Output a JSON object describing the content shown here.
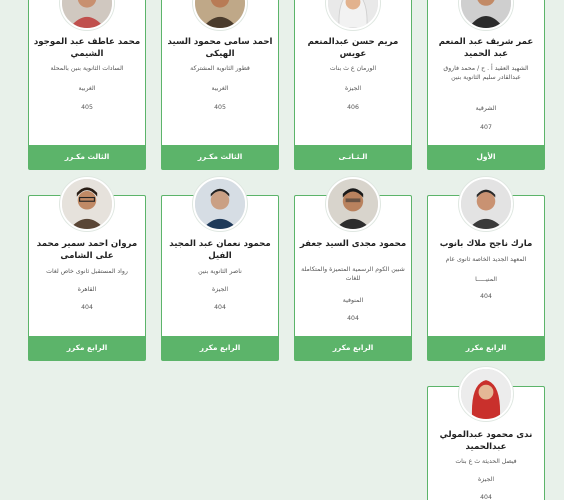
{
  "colors": {
    "accent": "#5cb46a",
    "background": "#e8f1ea",
    "card": "#ffffff"
  },
  "row1": [
    {
      "name": "عمر شريف عبد المنعم عبد الحميد",
      "school": "الشهيد العقيد أ . ح / محمد فاروق عبدالقادر سليم الثانوية بنين",
      "governorate": "الشرقية",
      "score": "407",
      "rank": "الأول",
      "avatar": "student-photo-icon"
    },
    {
      "name": "مريم حسن عبدالمنعم عويس",
      "school": "الورمان ع ث بنات",
      "governorate": "الجيزة",
      "score": "406",
      "rank": "الـثـانـى",
      "avatar": "student-photo-icon"
    },
    {
      "name": "احمد سامى محمود السيد الهيكى",
      "school": "قطور الثانوية المشتركة",
      "governorate": "الغربية",
      "score": "405",
      "rank": "الثالث مكـرر",
      "avatar": "student-photo-icon"
    },
    {
      "name": "محمد عاطف عبد الموجود الشيمي",
      "school": "السادات الثانوية بنين بالمحلة",
      "governorate": "الغربية",
      "score": "405",
      "rank": "الثالث مكـرر",
      "avatar": "student-photo-icon"
    }
  ],
  "row2": [
    {
      "name": "مارك ناجح ملاك بانوب",
      "school": "المعهد الجديد الخاصة ثانوى عام",
      "governorate": "المنيـــــا",
      "score": "404",
      "rank": "الرابع مكرر",
      "avatar": "student-photo-icon"
    },
    {
      "name": "محمود مجدى السيد جعفر",
      "school": "شبين الكوم الرسمية المتميزة والمتكاملة للغات",
      "governorate": "المنوفية",
      "score": "404",
      "rank": "الرابع مكرر",
      "avatar": "student-photo-icon"
    },
    {
      "name": "محمود نعمان عبد المجيد الفيل",
      "school": "ناصر الثانوية بنين",
      "governorate": "الجيزة",
      "score": "404",
      "rank": "الرابع مكرر",
      "avatar": "student-photo-icon"
    },
    {
      "name": "مروان احمد سمير محمد على الشامى",
      "school": "رواد المستقبل ثانوى خاص لغات",
      "governorate": "القاهرة",
      "score": "404",
      "rank": "الرابع مكرر",
      "avatar": "student-photo-icon"
    }
  ],
  "row3": [
    {
      "name": "ندى محمود عبدالمولي عبدالحميد",
      "school": "فيصل الحديثة ث ع بنات",
      "governorate": "الجيزة",
      "score": "404",
      "avatar": "student-photo-icon"
    }
  ]
}
